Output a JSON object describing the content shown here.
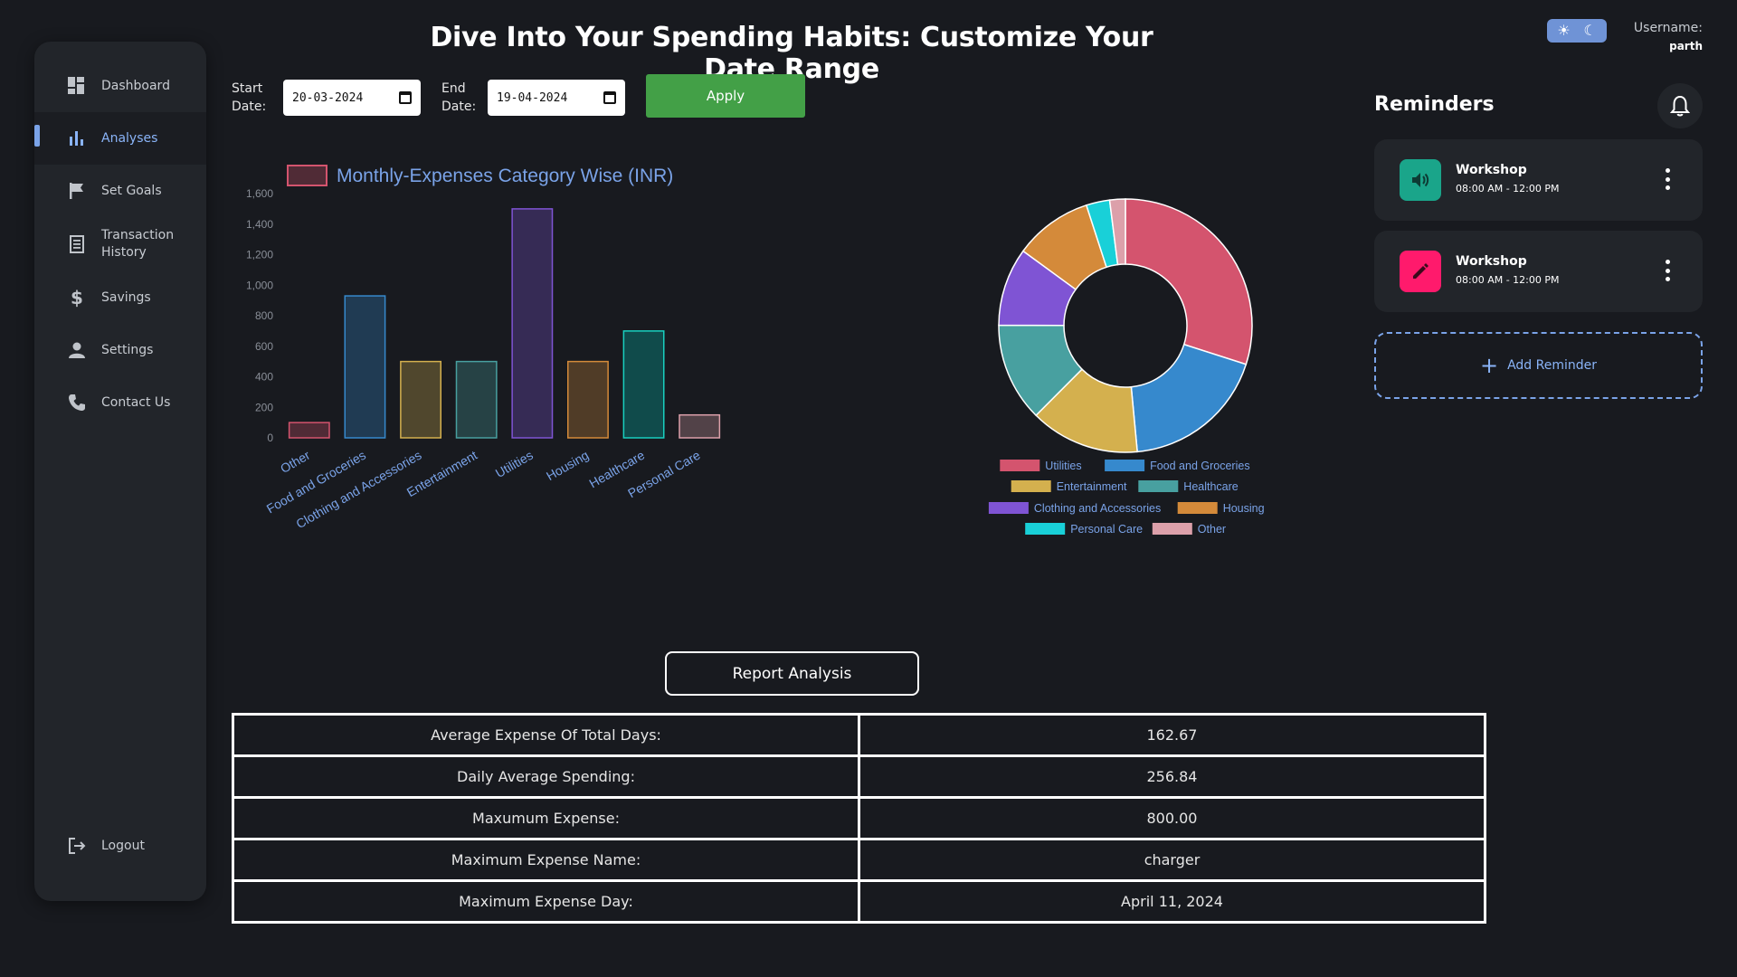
{
  "sidebar": {
    "items": [
      {
        "label": "Dashboard",
        "icon": "dashboard-icon"
      },
      {
        "label": "Analyses",
        "icon": "bar-chart-icon",
        "active": true
      },
      {
        "label": "Set Goals",
        "icon": "flag-icon"
      },
      {
        "label": "Transaction History",
        "icon": "receipt-icon"
      },
      {
        "label": "Savings",
        "icon": "dollar-icon"
      },
      {
        "label": "Settings",
        "icon": "person-icon"
      },
      {
        "label": "Contact Us",
        "icon": "phone-icon"
      }
    ],
    "logout_label": "Logout"
  },
  "header": {
    "title": "Dive Into Your Spending Habits: Customize Your Date Range",
    "username_label": "Username:",
    "username": "parth"
  },
  "date_range": {
    "start_label_1": "Start",
    "start_label_2": "Date:",
    "start_value": "20-03-2024",
    "end_label_1": "End",
    "end_label_2": "Date:",
    "end_value": "19-04-2024",
    "apply_label": "Apply"
  },
  "reminders": {
    "title": "Reminders",
    "items": [
      {
        "name": "Workshop",
        "time": "08:00 AM - 12:00 PM",
        "icon": "speaker-icon",
        "icon_color": "#1aa58a"
      },
      {
        "name": "Workshop",
        "time": "08:00 AM - 12:00 PM",
        "icon": "pencil-icon",
        "icon_color": "#ff1a6c"
      }
    ],
    "add_label": "Add Reminder"
  },
  "report": {
    "button_label": "Report Analysis",
    "rows": [
      {
        "label": "Average Expense Of Total Days:",
        "value": "162.67"
      },
      {
        "label": "Daily Average Spending:",
        "value": "256.84"
      },
      {
        "label": "Maxumum Expense:",
        "value": "800.00"
      },
      {
        "label": "Maximum Expense Name:",
        "value": "charger"
      },
      {
        "label": "Maximum Expense Day:",
        "value": "April 11, 2024"
      }
    ]
  },
  "colors": {
    "accent": "#8ab4f8",
    "apply": "#43a047",
    "background": "#181a1f",
    "panel": "#22252a"
  },
  "chart_data": [
    {
      "type": "bar",
      "legend": "Monthly-Expenses Category Wise (INR)",
      "categories": [
        "Other",
        "Food and Groceries",
        "Clothing and Accessories",
        "Entertainment",
        "Utilities",
        "Housing",
        "Healthcare",
        "Personal Care"
      ],
      "values": [
        100,
        930,
        500,
        500,
        1500,
        500,
        700,
        150
      ],
      "yticks": [
        "0",
        "200",
        "400",
        "600",
        "800",
        "1,000",
        "1,200",
        "1,400",
        "1,600"
      ],
      "ylim": [
        0,
        1600
      ],
      "fill_colors": [
        "rgba(212,84,110,0.3)",
        "rgba(54,137,205,0.3)",
        "rgba(212,176,78,0.3)",
        "rgba(72,160,160,0.3)",
        "rgba(127,84,212,0.3)",
        "rgba(212,138,58,0.3)",
        "rgba(0,190,180,0.3)",
        "rgba(220,160,170,0.3)"
      ],
      "stroke_colors": [
        "#d4546e",
        "#3689cd",
        "#d4b04e",
        "#48a0a0",
        "#7f54d4",
        "#d48a3a",
        "#19d0c0",
        "#dca0aa"
      ],
      "grid": false
    },
    {
      "type": "pie",
      "variant": "doughnut",
      "labels": [
        "Utilities",
        "Food and Groceries",
        "Entertainment",
        "Healthcare",
        "Clothing and Accessories",
        "Housing",
        "Personal Care",
        "Other"
      ],
      "values": [
        1500,
        930,
        700,
        630,
        500,
        500,
        150,
        100
      ],
      "colors": [
        "#d4546e",
        "#3689cd",
        "#d4b04e",
        "#48a0a0",
        "#7f54d4",
        "#d48a3a",
        "#19d0d8",
        "#dca0aa"
      ],
      "legend_position": "bottom"
    }
  ]
}
